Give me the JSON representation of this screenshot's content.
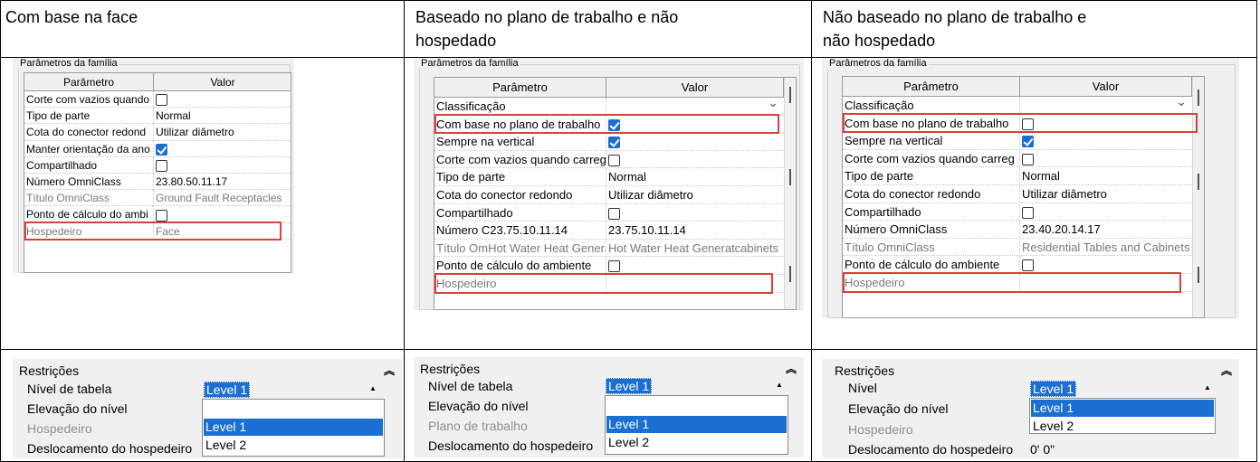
{
  "columns": [
    {
      "title": "Com base na face",
      "panel": {
        "group_label": "Parâmetros da família",
        "header": {
          "param": "Parâmetro",
          "value": "Valor"
        },
        "rows": [
          {
            "param": "Corte com vazios quando",
            "value": "",
            "checkbox": false,
            "grey": false
          },
          {
            "param": "Tipo de parte",
            "value": "Normal",
            "grey": false
          },
          {
            "param": "Cota do conector redond",
            "value": "Utilizar diâmetro",
            "grey": false
          },
          {
            "param": "Manter orientação da ano",
            "value": "",
            "checkbox": true,
            "grey": false
          },
          {
            "param": "Compartilhado",
            "value": "",
            "checkbox": false,
            "grey": false
          },
          {
            "param": "Número OmniClass",
            "value": "23.80.50.11.17",
            "grey": false
          },
          {
            "param": "Título OmniClass",
            "value": "Ground Fault Receptacles",
            "grey": true
          },
          {
            "param": "Ponto de cálculo do ambi",
            "value": "",
            "checkbox": false,
            "grey": false
          },
          {
            "param": "Hospedeiro",
            "value": "Face",
            "grey": true
          }
        ]
      },
      "restr": {
        "title": "Restrições",
        "labels": [
          "Nível de tabela",
          "Elevação do nível",
          "Hospedeiro",
          "Deslocamento do hospedeiro"
        ],
        "selected": "Level 1",
        "options": [
          "Level 1",
          "Level 2"
        ]
      }
    },
    {
      "title": "Baseado no plano de trabalho e não hospedado",
      "title_lines": [
        "Baseado no plano de trabalho e não",
        "hospedado"
      ],
      "panel": {
        "group_label": "Parâmetros da família",
        "header": {
          "param": "Parâmetro",
          "value": "Valor"
        },
        "rows": [
          {
            "param": "Classificação",
            "value": "",
            "dropdown": true,
            "grey": false
          },
          {
            "param": "Com base no plano de trabalho",
            "value": "",
            "checkbox": true,
            "grey": false
          },
          {
            "param": "Sempre na vertical",
            "value": "",
            "checkbox": true,
            "grey": false
          },
          {
            "param": "Corte com vazios quando carreg",
            "value": "",
            "checkbox": false,
            "grey": false
          },
          {
            "param": "Tipo de parte",
            "value": "Normal",
            "grey": false
          },
          {
            "param": "Cota do conector redondo",
            "value": "Utilizar diâmetro",
            "grey": false
          },
          {
            "param": "Compartilhado",
            "value": "",
            "checkbox": false,
            "grey": false
          },
          {
            "param": "Número C23.75.10.11.14",
            "value": "23.75.10.11.14",
            "grey": false
          },
          {
            "param": "Título OmHot Water Heat Genera",
            "value": "Hot Water Heat Generatcabinets",
            "grey": true
          },
          {
            "param": "Ponto de cálculo do ambiente",
            "value": "",
            "checkbox": false,
            "grey": false
          },
          {
            "param": "Hospedeiro",
            "value": "",
            "grey": true
          }
        ]
      },
      "restr": {
        "title": "Restrições",
        "labels": [
          "Nível de tabela",
          "Elevação do nível",
          "Plano de trabalho",
          "Deslocamento do hospedeiro"
        ],
        "selected": "Level 1",
        "options": [
          "Level 1",
          "Level 2"
        ]
      }
    },
    {
      "title": "Não baseado no plano de trabalho e não hospedado",
      "title_lines": [
        "Não baseado no plano de trabalho e",
        "não hospedado"
      ],
      "panel": {
        "group_label": "Parâmetros da família",
        "header": {
          "param": "Parâmetro",
          "value": "Valor"
        },
        "rows": [
          {
            "param": "Classificação",
            "value": "",
            "dropdown": true,
            "grey": false
          },
          {
            "param": "Com base no plano de trabalho",
            "value": "",
            "checkbox": false,
            "grey": false
          },
          {
            "param": "Sempre na vertical",
            "value": "",
            "checkbox": true,
            "grey": false
          },
          {
            "param": "Corte com vazios quando carreg",
            "value": "",
            "checkbox": false,
            "grey": false
          },
          {
            "param": "Tipo de parte",
            "value": "Normal",
            "grey": false
          },
          {
            "param": "Cota do conector redondo",
            "value": "Utilizar diâmetro",
            "grey": false
          },
          {
            "param": "Compartilhado",
            "value": "",
            "checkbox": false,
            "grey": false
          },
          {
            "param": "Número OmniClass",
            "value": "23.40.20.14.17",
            "grey": false
          },
          {
            "param": "Título OmniClass",
            "value": "Residential Tables and Cabinets",
            "grey": true
          },
          {
            "param": "Ponto de cálculo do ambiente",
            "value": "",
            "checkbox": false,
            "grey": false
          },
          {
            "param": "Hospedeiro",
            "value": "",
            "grey": true
          }
        ]
      },
      "restr": {
        "title": "Restrições",
        "labels": [
          "Nível",
          "Elevação do nível",
          "Hospedeiro",
          "Deslocamento do hospedeiro"
        ],
        "selected": "Level 1",
        "options": [
          "Level 1",
          "Level 2"
        ],
        "offset_value": "0'  0\""
      }
    }
  ],
  "colors": {
    "highlight": "#d9413a",
    "selection": "#1a6fd1"
  }
}
